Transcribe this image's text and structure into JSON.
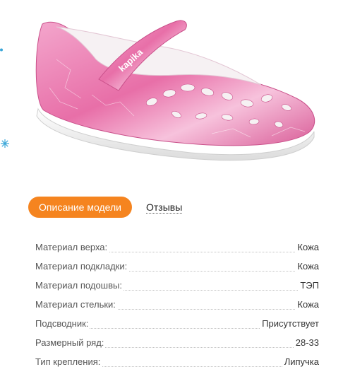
{
  "product": {
    "brand_text": "kapika"
  },
  "tabs": {
    "description_label": "Описание модели",
    "reviews_label": "Отзывы"
  },
  "specs": [
    {
      "label": "Материал верха:",
      "value": "Кожа"
    },
    {
      "label": "Материал подкладки:",
      "value": "Кожа"
    },
    {
      "label": "Материал подошвы:",
      "value": "ТЭП"
    },
    {
      "label": "Материал стельки:",
      "value": "Кожа"
    },
    {
      "label": "Подсводник:",
      "value": "Присутствует"
    },
    {
      "label": "Размерный ряд:",
      "value": "28-33"
    },
    {
      "label": "Тип крепления:",
      "value": "Липучка"
    }
  ],
  "colors": {
    "accent": "#f5841f",
    "shoe_pink": "#e86fa8",
    "decor_blue": "#3aa6d8"
  }
}
